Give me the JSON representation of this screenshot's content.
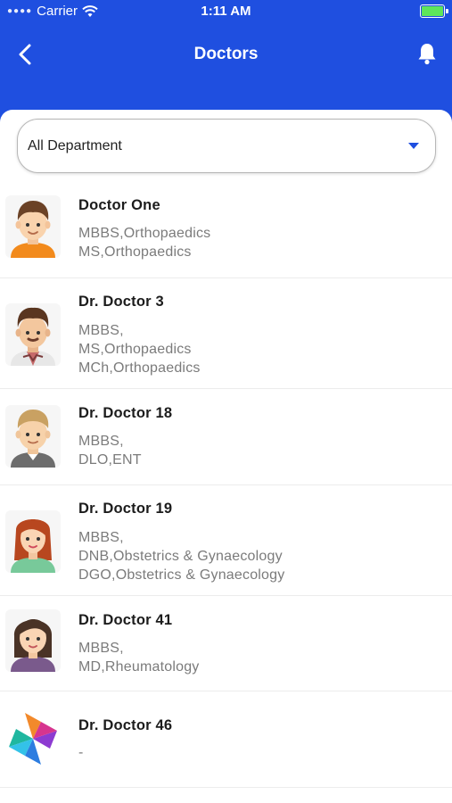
{
  "status_bar": {
    "carrier": "Carrier",
    "time": "1:11 AM"
  },
  "header": {
    "title": "Doctors"
  },
  "filter": {
    "department": "All Department"
  },
  "doctors": [
    {
      "name": "Doctor  One",
      "qualifications": [
        "MBBS,Orthopaedics",
        "MS,Orthopaedics"
      ]
    },
    {
      "name": "Dr. Doctor  3",
      "qualifications": [
        "MBBS,",
        "MS,Orthopaedics",
        "MCh,Orthopaedics"
      ]
    },
    {
      "name": "Dr. Doctor  18",
      "qualifications": [
        "MBBS,",
        "DLO,ENT"
      ]
    },
    {
      "name": "Dr. Doctor  19",
      "qualifications": [
        "MBBS,",
        "DNB,Obstetrics & Gynaecology",
        "DGO,Obstetrics & Gynaecology"
      ]
    },
    {
      "name": "Dr. Doctor  41",
      "qualifications": [
        "MBBS,",
        "MD,Rheumatology"
      ]
    },
    {
      "name": "Dr. Doctor  46",
      "qualifications": [
        "-"
      ]
    }
  ],
  "colors": {
    "primary": "#1f4fe0",
    "divider": "#ececec",
    "qualification_text": "#7b7b7b"
  }
}
